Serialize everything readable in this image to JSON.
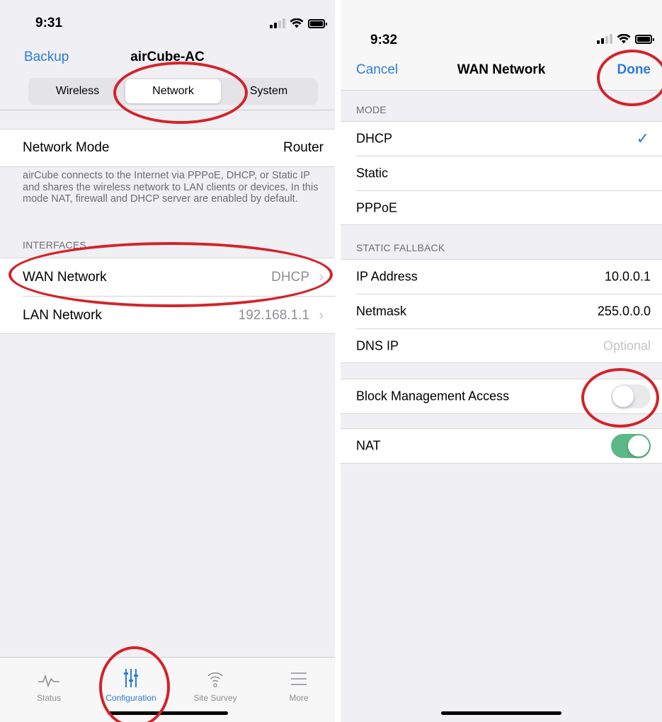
{
  "left": {
    "status_time": "9:31",
    "nav": {
      "back_label": "Backup",
      "title": "airCube-AC"
    },
    "segments": [
      "Wireless",
      "Network",
      "System"
    ],
    "network_mode": {
      "label": "Network Mode",
      "value": "Router"
    },
    "description": "airCube connects to the Internet via PPPoE, DHCP, or Static IP and shares the wireless network to LAN clients or devices. In this mode NAT, firewall and DHCP server are enabled by default.",
    "interfaces_header": "INTERFACES",
    "interfaces": [
      {
        "label": "WAN Network",
        "value": "DHCP"
      },
      {
        "label": "LAN Network",
        "value": "192.168.1.1"
      }
    ],
    "tabs": [
      {
        "label": "Status",
        "icon": "pulse-icon"
      },
      {
        "label": "Configuration",
        "icon": "sliders-icon"
      },
      {
        "label": "Site Survey",
        "icon": "antenna-icon"
      },
      {
        "label": "More",
        "icon": "menu-icon"
      }
    ]
  },
  "right": {
    "status_time": "9:32",
    "nav": {
      "cancel_label": "Cancel",
      "title": "WAN Network",
      "done_label": "Done"
    },
    "mode_header": "MODE",
    "modes": [
      "DHCP",
      "Static",
      "PPPoE"
    ],
    "selected_mode": "DHCP",
    "fallback_header": "STATIC FALLBACK",
    "fallback": [
      {
        "label": "IP Address",
        "value": "10.0.0.1"
      },
      {
        "label": "Netmask",
        "value": "255.0.0.0"
      },
      {
        "label": "DNS IP",
        "placeholder": "Optional"
      }
    ],
    "block_management": {
      "label": "Block Management Access",
      "on": false
    },
    "nat": {
      "label": "NAT",
      "on": true
    }
  },
  "colors": {
    "accent": "#2f7ad6",
    "annotation": "#d3232a",
    "toggle_on": "#5cb887"
  }
}
